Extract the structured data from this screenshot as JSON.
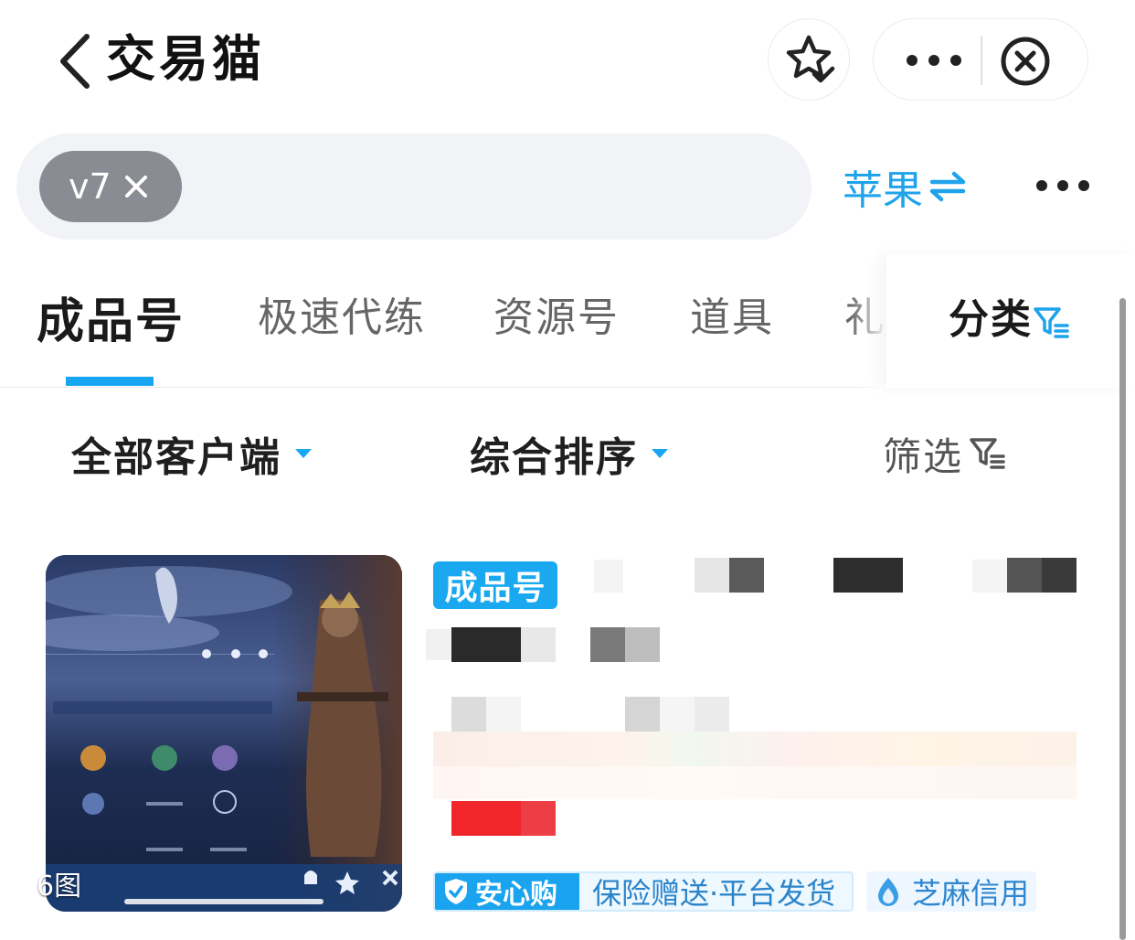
{
  "header": {
    "title": "交易猫",
    "icons": {
      "back": "chevron-left-icon",
      "favorite": "star-check-icon",
      "more": "ellipsis-icon",
      "close": "close-circle-icon"
    }
  },
  "search": {
    "chip_label": "v7",
    "platform_label": "苹果",
    "platform_icon": "swap-arrows-icon"
  },
  "tabs": {
    "items": [
      "成品号",
      "极速代练",
      "资源号",
      "道具",
      "礼"
    ],
    "active_index": 0,
    "category_label": "分类"
  },
  "filters": {
    "client": "全部客户端",
    "sort": "综合排序",
    "filter": "筛选"
  },
  "listing": {
    "image_count": "6图",
    "badge": "成品号",
    "tags": {
      "anxin_title": "安心购",
      "anxin_text": "保险赠送·平台发货",
      "credit": "芝麻信用"
    }
  },
  "colors": {
    "accent": "#17a6f2",
    "price_red": "#f0262b",
    "chip_gray": "#8a8c93",
    "search_bg": "#f2f3f7"
  }
}
